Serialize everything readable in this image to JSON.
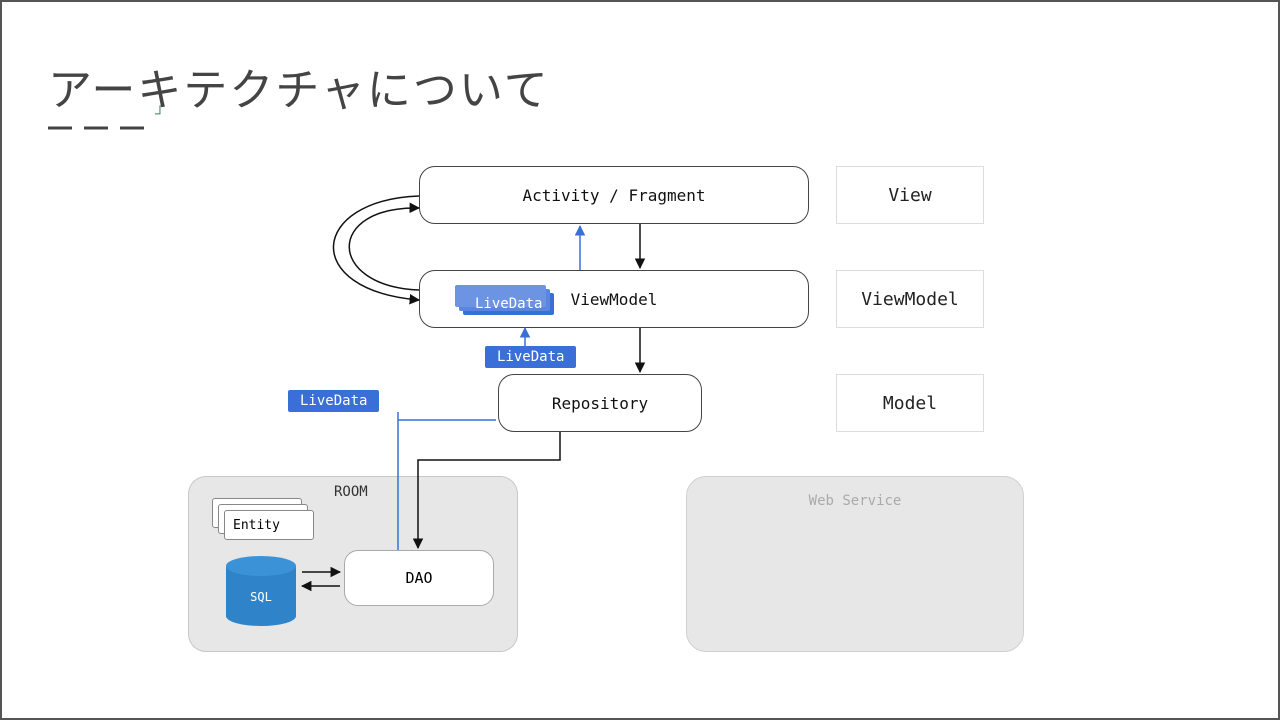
{
  "title": "アーキテクチャについて",
  "layers": {
    "activity": "Activity / Fragment",
    "viewmodel": "ViewModel",
    "repository": "Repository"
  },
  "side_labels": {
    "view": "View",
    "viewmodel": "ViewModel",
    "model": "Model"
  },
  "tags": {
    "livedata": "LiveData"
  },
  "room": {
    "title": "ROOM",
    "entity": "Entity",
    "sql": "SQL",
    "dao": "DAO"
  },
  "web_service": "Web Service",
  "colors": {
    "blue": "#3b6fd8",
    "db": "#2f84c9",
    "grey": "#e7e7e7"
  }
}
